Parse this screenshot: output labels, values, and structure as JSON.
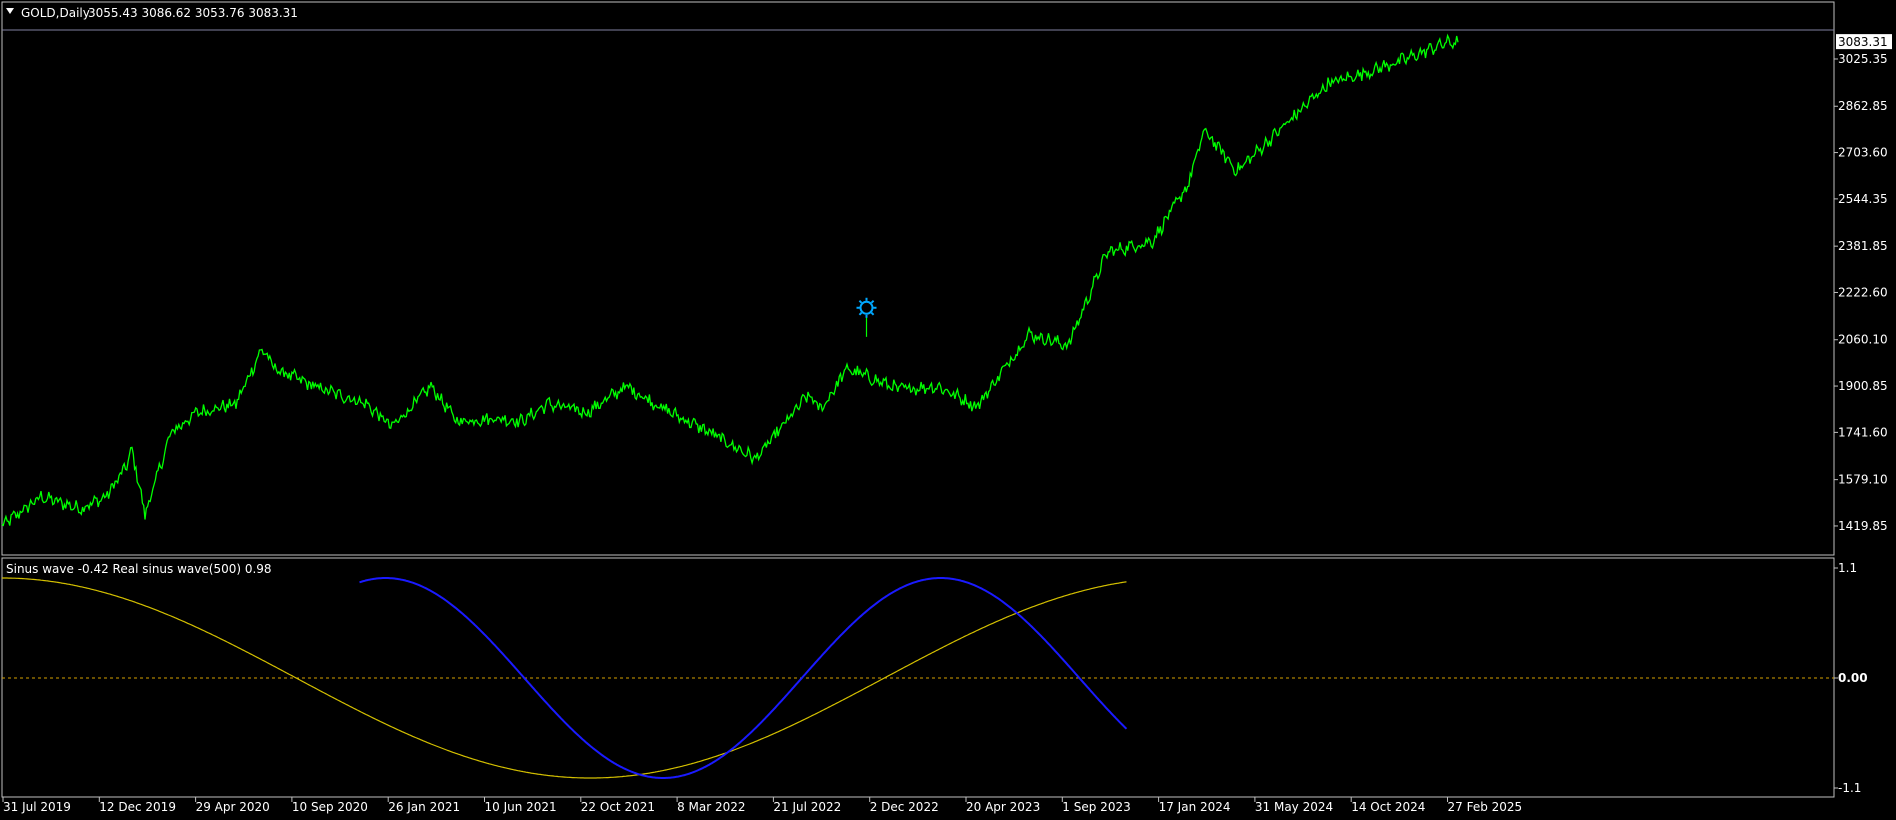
{
  "window": {
    "symbol_label": "GOLD,Daily",
    "ohlc": "3055.43 3086.62 3053.76 3083.31"
  },
  "indicator": {
    "label": "Sinus wave -0.42  Real sinus wave(500) 0.98"
  },
  "colors": {
    "background": "#000000",
    "price_line": "#00ff00",
    "axis_text": "#ffffff",
    "grid_border": "#c0c0c0",
    "sinus_wave": "#d4c000",
    "real_sinus_wave": "#1a1aff",
    "zero_line": "#d4a000",
    "alert_icon": "#00a8ff"
  },
  "icons": {
    "alert": "sun-alert-icon",
    "menu": "triangle-down-icon"
  },
  "chart_data": [
    {
      "type": "line",
      "name": "price",
      "current_price_label": "3083.31",
      "current_price": 3083.31,
      "y_tick_labels": [
        "3025.35",
        "2862.85",
        "2703.60",
        "2544.35",
        "2381.85",
        "2222.60",
        "2060.10",
        "1900.85",
        "1741.60",
        "1579.10",
        "1419.85"
      ],
      "ylim": [
        1320,
        3125
      ],
      "grid": false,
      "x_index_range": [
        0,
        1120
      ],
      "alert_marker": {
        "x": 665,
        "y": 2170
      },
      "series": [
        {
          "x": [
            0,
            30,
            60,
            80,
            95,
            100,
            110,
            130,
            150,
            180,
            200,
            210,
            240,
            280,
            300,
            330,
            350,
            380,
            400,
            420,
            450,
            480,
            510,
            545,
            580,
            620,
            630,
            650,
            690,
            720,
            750,
            790,
            820,
            850,
            885,
            912,
            925,
            950,
            1020,
            1050,
            1080,
            1110,
            1120
          ],
          "y": [
            1420,
            1520,
            1480,
            1520,
            1620,
            1680,
            1460,
            1740,
            1810,
            1840,
            2030,
            1960,
            1900,
            1840,
            1760,
            1900,
            1780,
            1790,
            1780,
            1840,
            1810,
            1900,
            1820,
            1740,
            1650,
            1870,
            1820,
            1960,
            1890,
            1900,
            1830,
            2080,
            2040,
            2360,
            2400,
            2590,
            2780,
            2640,
            2940,
            2980,
            3025,
            3080,
            3083
          ]
        }
      ]
    },
    {
      "type": "line",
      "name": "sinus wave indicator",
      "y_tick_labels": [
        "1.1",
        "0.00",
        "-1.1"
      ],
      "ylim": [
        -1.1,
        1.1
      ],
      "zero_line": 0,
      "series": [
        {
          "name": "Sinus wave",
          "x_start": 0,
          "x_end": 865,
          "amplitude": 1.0,
          "period": 905,
          "phase_x": 0,
          "function": "cos"
        },
        {
          "name": "Real sinus wave",
          "x_start": 275,
          "x_end": 865,
          "amplitude": 1.0,
          "period": 427,
          "phase_x": 295,
          "function": "cos"
        }
      ]
    }
  ],
  "x_axis": {
    "tick_labels": [
      "31 Jul 2019",
      "12 Dec 2019",
      "29 Apr 2020",
      "10 Sep 2020",
      "26 Jan 2021",
      "10 Jun 2021",
      "22 Oct 2021",
      "8 Mar 2022",
      "21 Jul 2022",
      "2 Dec 2022",
      "20 Apr 2023",
      "1 Sep 2023",
      "17 Jan 2024",
      "31 May 2024",
      "14 Oct 2024",
      "27 Feb 2025"
    ]
  }
}
